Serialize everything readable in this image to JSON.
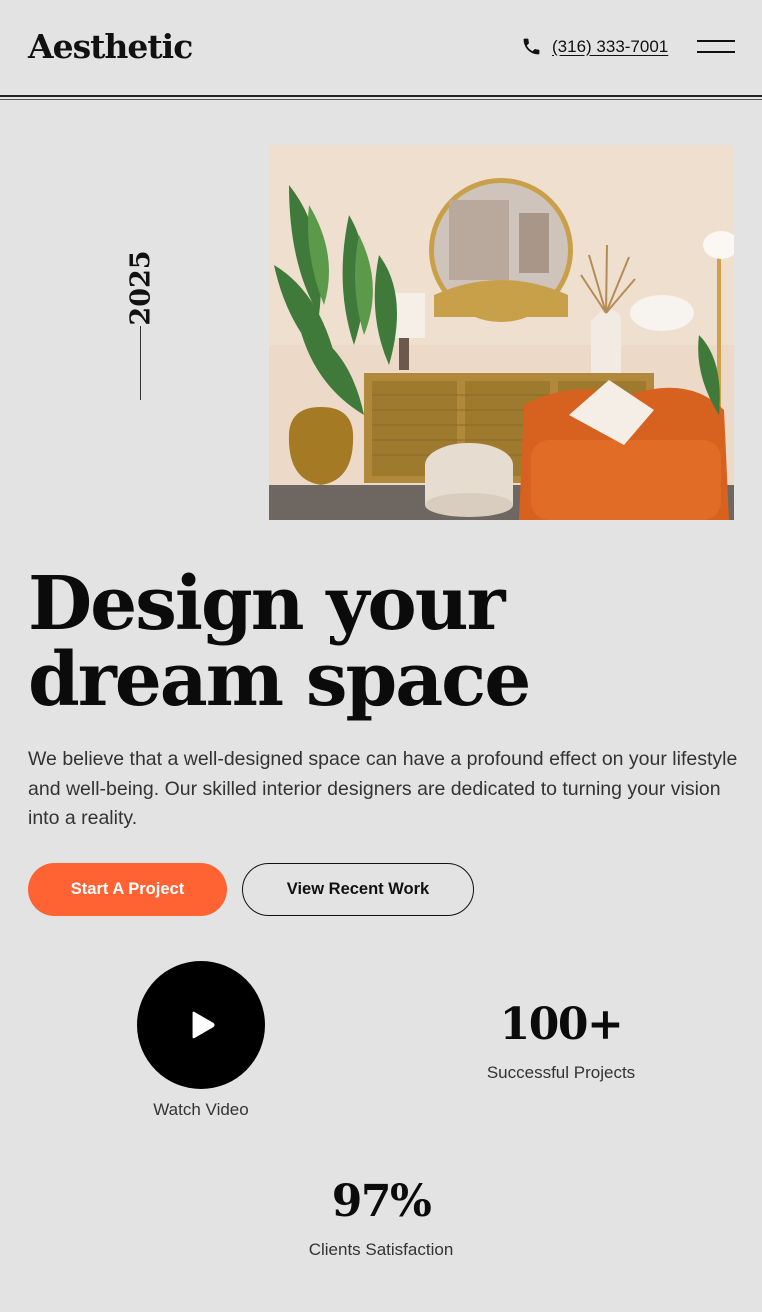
{
  "header": {
    "logo": "Aesthetic",
    "phone": "(316) 333-7001",
    "phone_icon": "phone-icon",
    "menu_icon": "hamburger-menu-icon"
  },
  "hero": {
    "year": "2025",
    "headline_line1": "Design your",
    "headline_line2": "dream space",
    "lead": "We believe that a well-designed space can have a profound effect on your lifestyle and well-being. Our skilled interior designers are dedicated to turning your vision into a reality.",
    "primary_button": "Start A Project",
    "secondary_button": "View Recent Work"
  },
  "video": {
    "label": "Watch Video",
    "icon": "play-icon"
  },
  "stats": [
    {
      "value": "100+",
      "label": "Successful Projects"
    },
    {
      "value": "97%",
      "label": "Clients Satisfaction"
    }
  ],
  "colors": {
    "background": "#e3e3e3",
    "accent": "#ff6233",
    "text": "#111111"
  }
}
